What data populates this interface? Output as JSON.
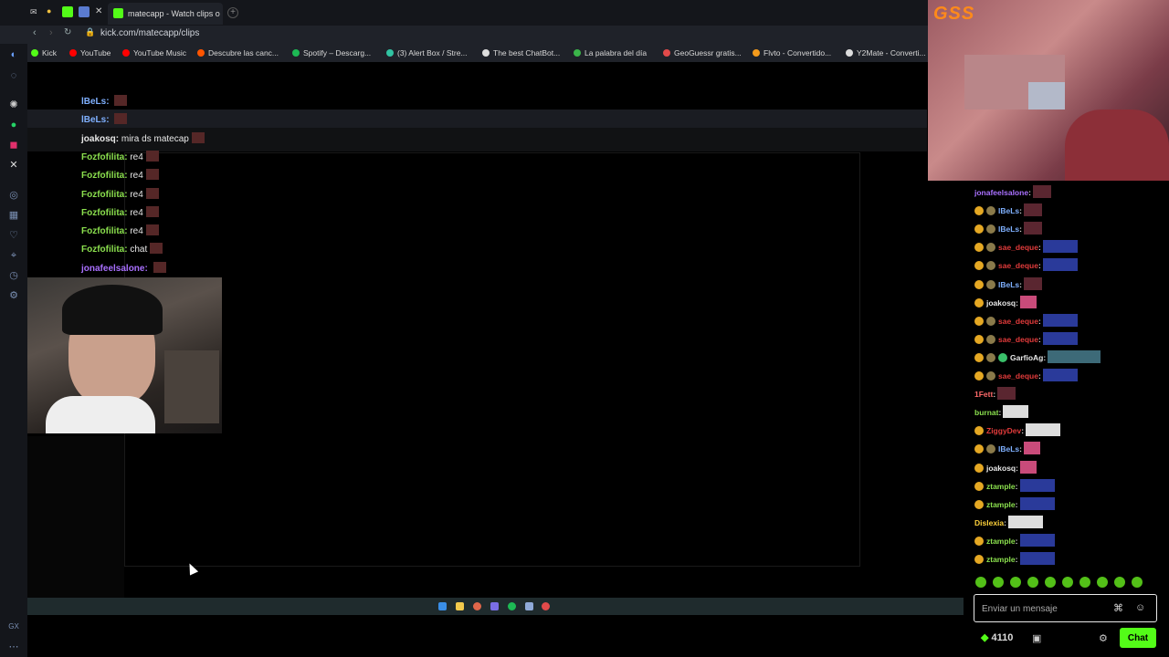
{
  "browser": {
    "tab_title": "matecapp - Watch clips o",
    "url": "kick.com/matecapp/clips",
    "bookmarks": [
      {
        "label": "Kick",
        "color": "#53fc18"
      },
      {
        "label": "YouTube",
        "color": "#ff0000"
      },
      {
        "label": "YouTube Music",
        "color": "#ff0000"
      },
      {
        "label": "Descubre las canc...",
        "color": "#ff5500"
      },
      {
        "label": "Spotify – Descarg...",
        "color": "#1db954"
      },
      {
        "label": "(3) Alert Box / Stre...",
        "color": "#31c3a2"
      },
      {
        "label": "The best ChatBot...",
        "color": "#dddddd"
      },
      {
        "label": "La palabra del día",
        "color": "#3bb54a"
      },
      {
        "label": "GeoGuessr gratis...",
        "color": "#e24a4a"
      },
      {
        "label": "Flvto - Convertido...",
        "color": "#f49b1c"
      },
      {
        "label": "Y2Mate - Converti...",
        "color": "#dddddd"
      }
    ]
  },
  "stream_overlay_chat": [
    {
      "user": "lBeLs",
      "sep": ":",
      "msg": "",
      "color": "#7fb0ff",
      "emote": true
    },
    {
      "user": "lBeLs",
      "sep": ":",
      "msg": "",
      "color": "#7fb0ff",
      "emote": true
    },
    {
      "user": "joakosq",
      "sep": ":",
      "msg": "mira ds matecap",
      "color": "#e8e8e8",
      "emote": true
    },
    {
      "user": "Fozfofilita",
      "sep": ":",
      "msg": "re4",
      "color": "#8be04e",
      "emote": true
    },
    {
      "user": "Fozfofilita",
      "sep": ":",
      "msg": "re4",
      "color": "#8be04e",
      "emote": true
    },
    {
      "user": "Fozfofilita",
      "sep": ":",
      "msg": "re4",
      "color": "#8be04e",
      "emote": true
    },
    {
      "user": "Fozfofilita",
      "sep": ":",
      "msg": "re4",
      "color": "#8be04e",
      "emote": true
    },
    {
      "user": "Fozfofilita",
      "sep": ":",
      "msg": "re4",
      "color": "#8be04e",
      "emote": true
    },
    {
      "user": "Fozfofilita",
      "sep": ":",
      "msg": "chat",
      "color": "#8be04e",
      "emote": true
    },
    {
      "user": "jonafeelsalone",
      "sep": ":",
      "msg": "",
      "color": "#a970ff",
      "emote": true
    }
  ],
  "facecam_logo": "GSS",
  "chat": {
    "messages": [
      {
        "user": "jonafeelsalone",
        "color": "#a970ff",
        "badges": 0,
        "emote_color": "#5a2630",
        "emote_w": 20
      },
      {
        "user": "lBeLs",
        "color": "#7fb0ff",
        "badges": 2,
        "emote_color": "#5a2630",
        "emote_w": 20
      },
      {
        "user": "lBeLs",
        "color": "#7fb0ff",
        "badges": 2,
        "emote_color": "#5a2630",
        "emote_w": 20
      },
      {
        "user": "sae_deque",
        "color": "#e23b3b",
        "badges": 2,
        "emote_color": "#2a3a9a",
        "emote_w": 38
      },
      {
        "user": "sae_deque",
        "color": "#e23b3b",
        "badges": 2,
        "emote_color": "#2a3a9a",
        "emote_w": 38
      },
      {
        "user": "lBeLs",
        "color": "#7fb0ff",
        "badges": 2,
        "emote_color": "#5a2630",
        "emote_w": 20
      },
      {
        "user": "joakosq",
        "color": "#e8e8e8",
        "badges": 1,
        "emote_color": "#c94b7a",
        "emote_w": 18
      },
      {
        "user": "sae_deque",
        "color": "#e23b3b",
        "badges": 2,
        "emote_color": "#2a3a9a",
        "emote_w": 38
      },
      {
        "user": "sae_deque",
        "color": "#e23b3b",
        "badges": 2,
        "emote_color": "#2a3a9a",
        "emote_w": 38
      },
      {
        "user": "GarfioAg",
        "color": "#e8e8e8",
        "badges": 3,
        "emote_color": "#3d6a78",
        "emote_w": 58
      },
      {
        "user": "sae_deque",
        "color": "#e23b3b",
        "badges": 2,
        "emote_color": "#2a3a9a",
        "emote_w": 38
      },
      {
        "user": "1Fett",
        "color": "#ff6a6a",
        "badges": 0,
        "emote_color": "#5a2630",
        "emote_w": 20
      },
      {
        "user": "burnat",
        "color": "#8be04e",
        "badges": 0,
        "emote_color": "#dddddd",
        "emote_w": 28
      },
      {
        "user": "ZiggyDev",
        "color": "#e23b3b",
        "badges": 1,
        "emote_color": "#dddddd",
        "emote_w": 38
      },
      {
        "user": "lBeLs",
        "color": "#7fb0ff",
        "badges": 2,
        "emote_color": "#c94b7a",
        "emote_w": 18
      },
      {
        "user": "joakosq",
        "color": "#e8e8e8",
        "badges": 1,
        "emote_color": "#c94b7a",
        "emote_w": 18
      },
      {
        "user": "ztample",
        "color": "#8be04e",
        "badges": 1,
        "emote_color": "#2a3a9a",
        "emote_w": 38
      },
      {
        "user": "ztample",
        "color": "#8be04e",
        "badges": 1,
        "emote_color": "#2a3a9a",
        "emote_w": 38
      },
      {
        "user": "Dislexia",
        "color": "#ffd23b",
        "badges": 0,
        "emote_color": "#dddddd",
        "emote_w": 38
      },
      {
        "user": "ztample",
        "color": "#8be04e",
        "badges": 1,
        "emote_color": "#2a3a9a",
        "emote_w": 38
      },
      {
        "user": "ztample",
        "color": "#8be04e",
        "badges": 1,
        "emote_color": "#2a3a9a",
        "emote_w": 38
      }
    ],
    "input_placeholder": "Enviar un mensaje",
    "points": "4110",
    "send_label": "Chat"
  }
}
